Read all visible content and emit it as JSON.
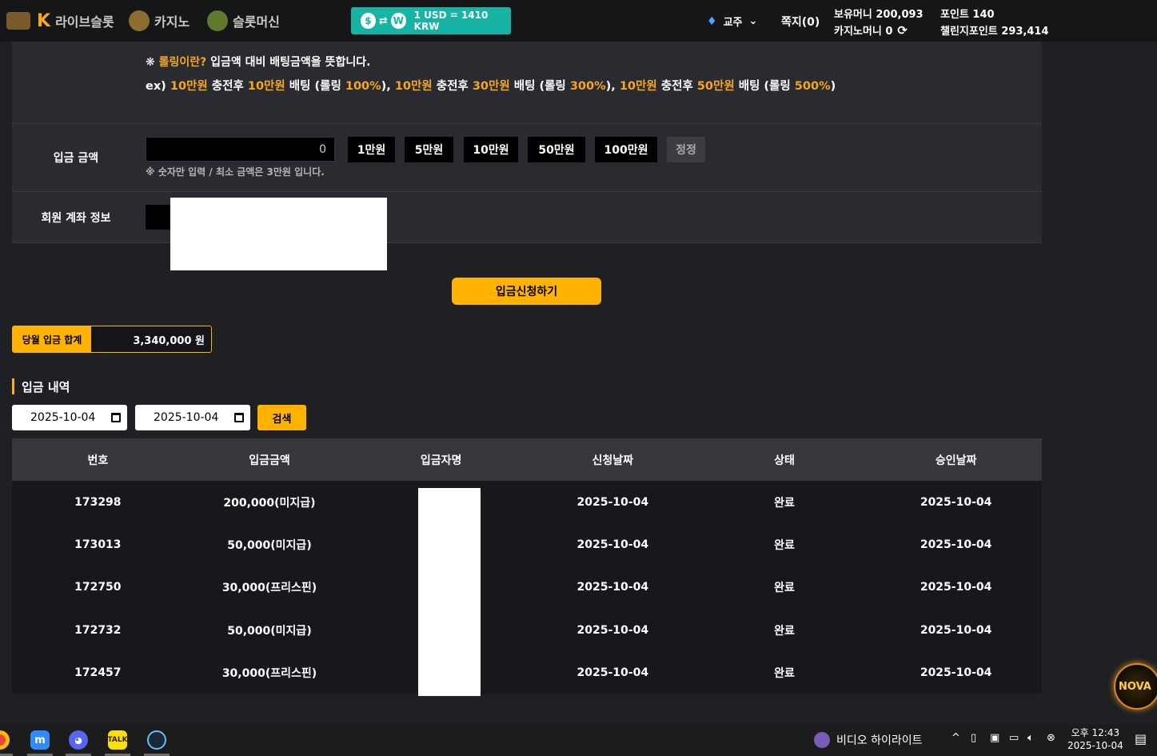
{
  "header": {
    "nav": [
      {
        "label": "라이브슬롯",
        "icon": "live-slot-logo-icon"
      },
      {
        "label": "카지노",
        "icon": "casino-crest-icon"
      },
      {
        "label": "슬롯머신",
        "icon": "slot-machine-icon"
      }
    ],
    "exchange_rate": "1 USD = 1410 KRW",
    "user_name": "교주",
    "messages": "쪽지(0)",
    "holding_money": "보유머니 200,093",
    "casino_money": "카지노머니 0",
    "points": "포인트 140",
    "challenge_points": "챌린지포인트 293,414"
  },
  "notice": {
    "line1_mark": "❋ ",
    "line1_highlight": "롤링이란?",
    "line1_rest": " 입금액 대비 배팅금액을 뜻합니다.",
    "line2": [
      {
        "t": "ex) ",
        "hl": false
      },
      {
        "t": "10만원",
        "hl": true
      },
      {
        "t": " 충전후 ",
        "hl": false
      },
      {
        "t": "10만원",
        "hl": true
      },
      {
        "t": " 배팅 (롤링 ",
        "hl": false
      },
      {
        "t": "100%",
        "hl": true
      },
      {
        "t": "), ",
        "hl": false
      },
      {
        "t": "10만원",
        "hl": true
      },
      {
        "t": " 충전후 ",
        "hl": false
      },
      {
        "t": "30만원",
        "hl": true
      },
      {
        "t": " 배팅 (롤링 ",
        "hl": false
      },
      {
        "t": "300%",
        "hl": true
      },
      {
        "t": "), ",
        "hl": false
      },
      {
        "t": "10만원",
        "hl": true
      },
      {
        "t": " 충전후 ",
        "hl": false
      },
      {
        "t": "50만원",
        "hl": true
      },
      {
        "t": " 배팅 (롤링 ",
        "hl": false
      },
      {
        "t": "500%",
        "hl": true
      },
      {
        "t": ")",
        "hl": false
      }
    ]
  },
  "deposit_form": {
    "amount_label": "입금 금액",
    "amount_value": "0",
    "quick_buttons": [
      "1만원",
      "5만원",
      "10만원",
      "50만원",
      "100만원"
    ],
    "reset_button": "정정",
    "hint": "※ 숫자만 입력 / 최소 금액은 3만원 입니다.",
    "account_label": "회원 계좌 정보",
    "submit": "입금신청하기"
  },
  "month_total": {
    "label": "당월 입금 합계",
    "value": "3,340,000 원"
  },
  "history": {
    "title": "입금 내역",
    "date_from": "2025-10-04",
    "date_to": "2025-10-04",
    "search": "검색",
    "columns": [
      "번호",
      "입금금액",
      "입금자명",
      "신청날짜",
      "상태",
      "승인날짜"
    ],
    "rows": [
      [
        "173298",
        "200,000(미지급)",
        "",
        "2025-10-04",
        "완료",
        "2025-10-04"
      ],
      [
        "173013",
        "50,000(미지급)",
        "",
        "2025-10-04",
        "완료",
        "2025-10-04"
      ],
      [
        "172750",
        "30,000(프리스핀)",
        "",
        "2025-10-04",
        "완료",
        "2025-10-04"
      ],
      [
        "172732",
        "50,000(미지급)",
        "",
        "2025-10-04",
        "완료",
        "2025-10-04"
      ],
      [
        "172457",
        "30,000(프리스핀)",
        "",
        "2025-10-04",
        "완료",
        "2025-10-04"
      ]
    ]
  },
  "fab_label": "NOVA",
  "taskbar": {
    "apps": [
      "chrome-icon",
      "maum-icon",
      "discord-icon",
      "kakaotalk-icon",
      "steam-icon"
    ],
    "kakao_label": "TALK",
    "tray_app": "비디오 하이라이트",
    "time": "오후 12:43",
    "date": "2025-10-04"
  }
}
